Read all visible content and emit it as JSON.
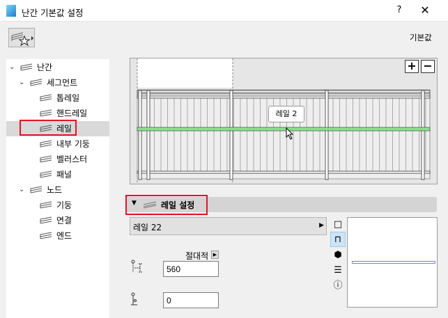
{
  "window": {
    "title": "난간 기본값 설정",
    "help": "?",
    "close": "✕"
  },
  "toolbar": {
    "default_label": "기본값"
  },
  "tree": [
    {
      "label": "난간",
      "icon": "railing-icon",
      "expanded": true
    },
    {
      "label": "세그먼트",
      "icon": "segment-icon",
      "expanded": true
    },
    {
      "label": "톱레일",
      "icon": "toprail-icon"
    },
    {
      "label": "핸드레일",
      "icon": "handrail-icon"
    },
    {
      "label": "레일",
      "icon": "rail-icon",
      "selected": true
    },
    {
      "label": "내부 기둥",
      "icon": "inner-post-icon"
    },
    {
      "label": "벨러스터",
      "icon": "baluster-icon"
    },
    {
      "label": "패널",
      "icon": "panel-icon"
    },
    {
      "label": "노드",
      "icon": "node-icon",
      "expanded": true
    },
    {
      "label": "기둥",
      "icon": "post-icon"
    },
    {
      "label": "연결",
      "icon": "connection-icon"
    },
    {
      "label": "엔드",
      "icon": "end-icon"
    }
  ],
  "preview": {
    "tooltip": "레일 2",
    "zoom_in": "+",
    "zoom_out": "−",
    "highlight_color": "#8ee08e"
  },
  "section": {
    "title": "레일 설정"
  },
  "settings": {
    "rail_type": "레일 22",
    "reference": "절대적",
    "height": "560",
    "offset": "0"
  }
}
